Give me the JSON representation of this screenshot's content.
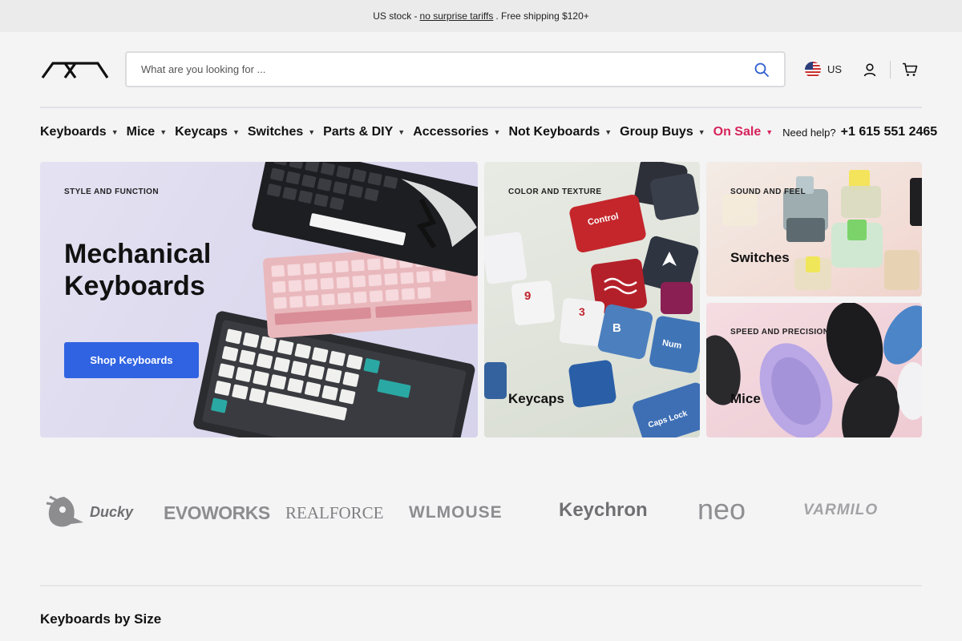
{
  "announcement": {
    "prefix": "US stock -",
    "link": "no surprise tariffs",
    "suffix": ". Free shipping $120+"
  },
  "header": {
    "search_placeholder": "What are you looking for ...",
    "country": "US"
  },
  "nav": {
    "items": [
      {
        "label": "Keyboards"
      },
      {
        "label": "Mice"
      },
      {
        "label": "Keycaps"
      },
      {
        "label": "Switches"
      },
      {
        "label": "Parts & DIY"
      },
      {
        "label": "Accessories"
      },
      {
        "label": "Not Keyboards"
      },
      {
        "label": "Group Buys"
      },
      {
        "label": "On Sale"
      }
    ],
    "help": "Need help?",
    "phone": "+1 615 551 2465",
    "sale_color": "#d6245a"
  },
  "hero": {
    "eyebrow": "STYLE AND FUNCTION",
    "title": "Mechanical Keyboards",
    "button": "Shop Keyboards",
    "button_color": "#3063e2"
  },
  "tiles": {
    "keycaps": {
      "eyebrow": "COLOR AND TEXTURE",
      "label": "Keycaps",
      "caps": [
        "Control",
        "9",
        "3",
        "B",
        "Num",
        "Caps Lock"
      ]
    },
    "switches": {
      "eyebrow": "SOUND AND FEEL",
      "label": "Switches"
    },
    "mice": {
      "eyebrow": "SPEED AND PRECISION",
      "label": "Mice"
    }
  },
  "brands": [
    "Ducky",
    "EVOWORKS",
    "REALFORCE",
    "WLMOUSE",
    "Keychron",
    "neo",
    "VARMILO"
  ],
  "section": {
    "title": "Keyboards by Size"
  }
}
